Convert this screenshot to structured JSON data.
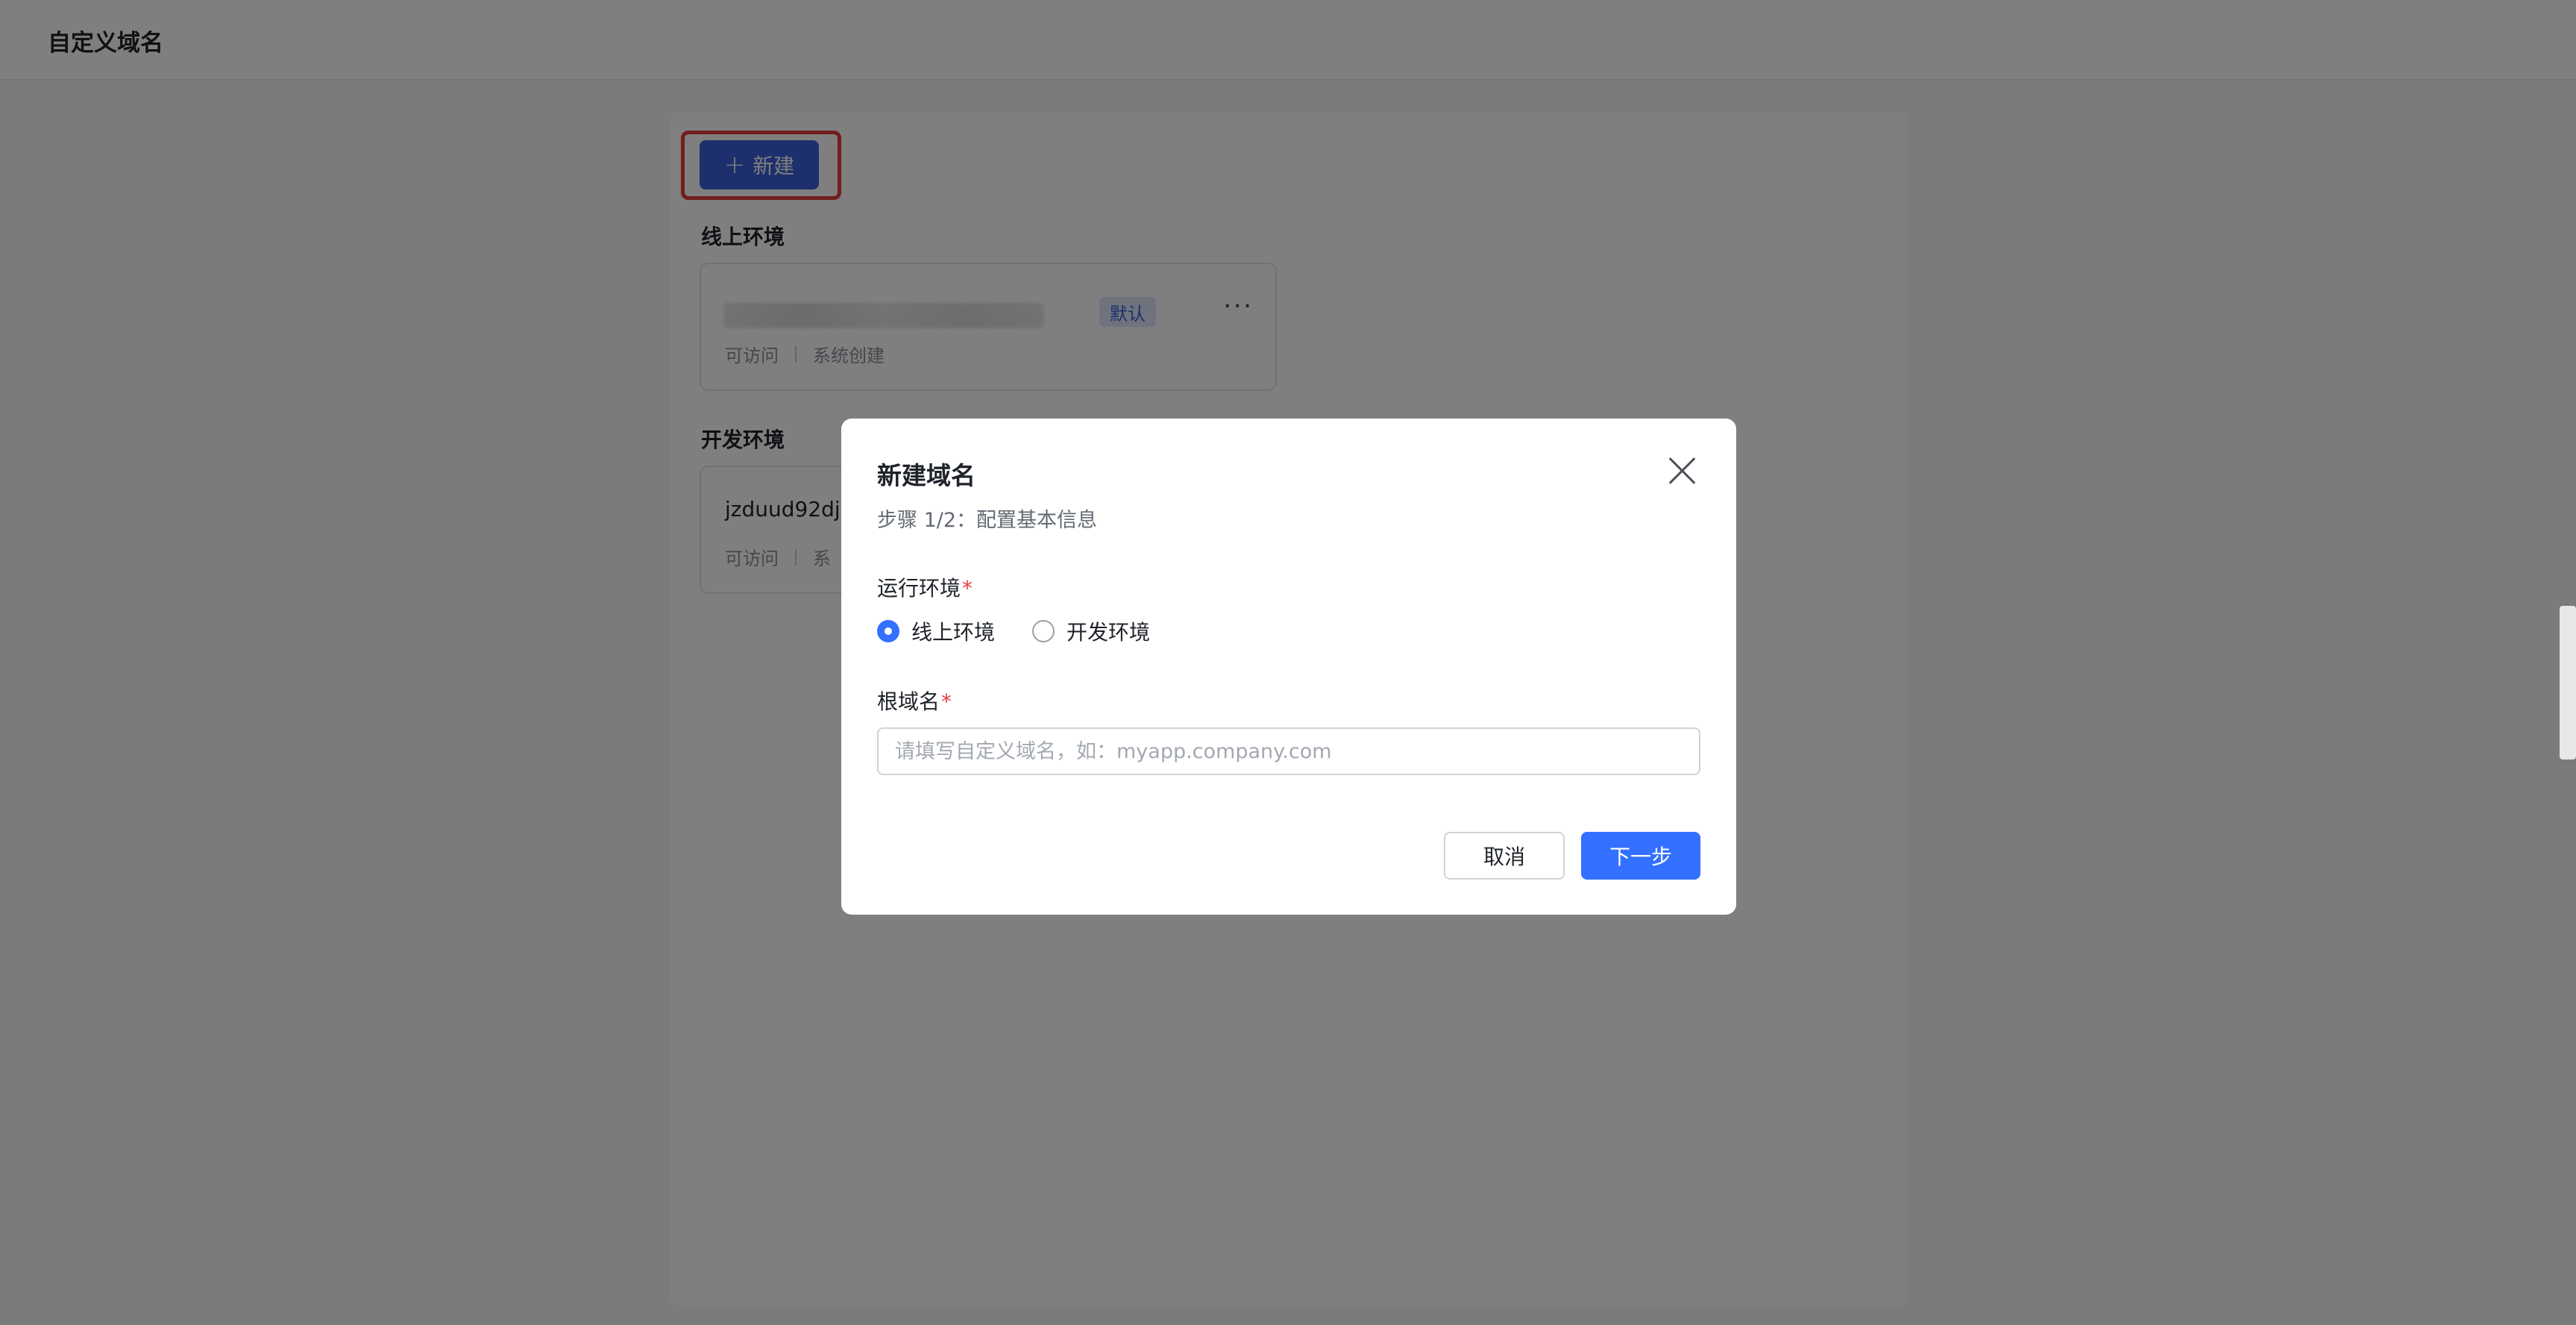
{
  "header": {
    "title": "自定义域名"
  },
  "toolbar": {
    "new_button_label": "新建"
  },
  "online_section": {
    "title": "线上环境",
    "card": {
      "badge": "默认",
      "status": "可访问",
      "source": "系统创建"
    }
  },
  "dev_section": {
    "title": "开发环境",
    "card": {
      "domain": "jzduud92dj-",
      "status": "可访问",
      "source": "系"
    }
  },
  "modal": {
    "title": "新建域名",
    "subtitle": "步骤 1/2：配置基本信息",
    "env_label": "运行环境",
    "env_options": [
      {
        "label": "线上环境",
        "selected": true
      },
      {
        "label": "开发环境",
        "selected": false
      }
    ],
    "root_domain_label": "根域名",
    "required_mark": "*",
    "root_domain_placeholder": "请填写自定义域名，如：myapp.company.com",
    "root_domain_value": "",
    "cancel_label": "取消",
    "next_label": "下一步"
  },
  "colors": {
    "primary": "#3370ff",
    "accent_button": "#3b5ed8",
    "highlight_border": "#e63a3a",
    "required": "#e63a3a"
  },
  "icons": {
    "new_button": "plus-icon",
    "card_actions": "more-icon",
    "modal_close": "close-icon"
  }
}
